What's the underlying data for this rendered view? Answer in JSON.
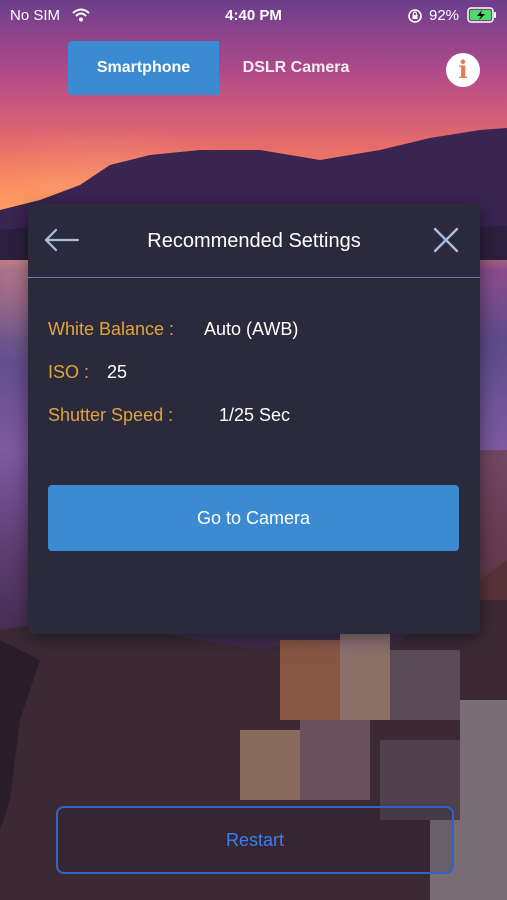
{
  "status_bar": {
    "carrier": "No SIM",
    "time": "4:40 PM",
    "battery_percent": "92%",
    "wifi_icon": "wifi-icon",
    "rotation_lock_icon": "rotation-lock-icon",
    "battery_icon": "battery-charging-icon"
  },
  "tabs": {
    "smartphone": "Smartphone",
    "dslr": "DSLR Camera",
    "active": "Smartphone"
  },
  "info_button": {
    "label": "i"
  },
  "modal": {
    "title": "Recommended Settings",
    "back_icon": "arrow-left-icon",
    "close_icon": "close-icon",
    "settings": {
      "white_balance_label": "White Balance :",
      "white_balance_value": "Auto (AWB)",
      "iso_label": "ISO :",
      "iso_value": "25",
      "shutter_label": "Shutter Speed :",
      "shutter_value": "1/25 Sec"
    },
    "go_button": "Go to Camera"
  },
  "restart_button": "Restart",
  "colors": {
    "accent_blue": "#3a8bd1",
    "label_orange": "#e0a43a",
    "modal_bg": "#2b2a3c",
    "restart_blue": "#3e7df0"
  }
}
